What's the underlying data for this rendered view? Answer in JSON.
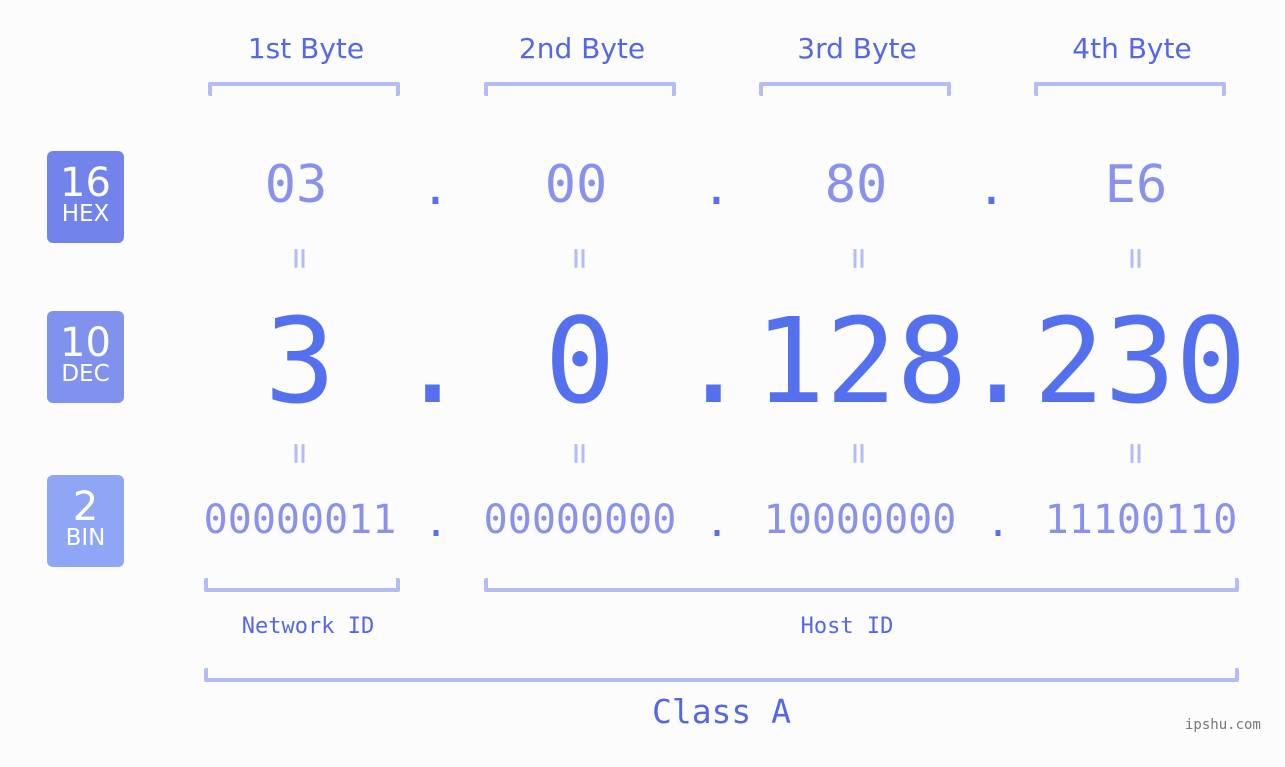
{
  "headers": [
    "1st Byte",
    "2nd Byte",
    "3rd Byte",
    "4th Byte"
  ],
  "badges": {
    "hex": {
      "number": "16",
      "label": "HEX",
      "color": "#7383ec"
    },
    "dec": {
      "number": "10",
      "label": "DEC",
      "color": "#8091ee"
    },
    "bin": {
      "number": "2",
      "label": "BIN",
      "color": "#8fa5f6"
    }
  },
  "separator": ".",
  "equals": "=",
  "hex": [
    "03",
    "00",
    "80",
    "E6"
  ],
  "dec": [
    "3",
    "0",
    "128",
    "230"
  ],
  "bin": [
    "00000011",
    "00000000",
    "10000000",
    "11100110"
  ],
  "network_id_label": "Network ID",
  "host_id_label": "Host ID",
  "class_label": "Class A",
  "watermark": "ipshu.com",
  "colors": {
    "accent": "#5570ee",
    "light_value": "#8892ec",
    "bracket": "#b3bcf7",
    "header_text": "#5468e6"
  }
}
